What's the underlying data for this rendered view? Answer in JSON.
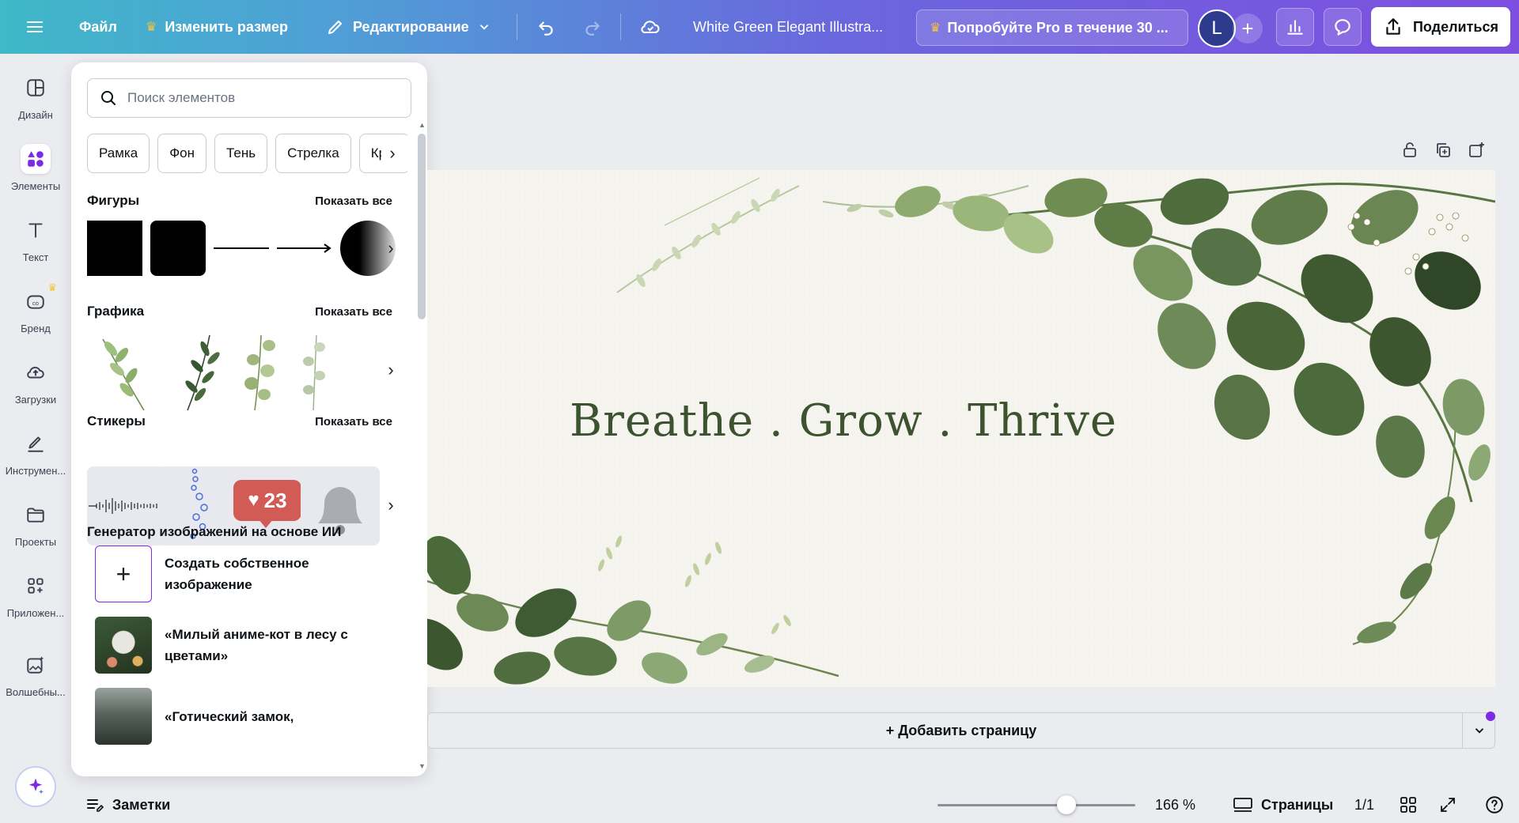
{
  "topbar": {
    "file_label": "Файл",
    "resize_label": "Изменить размер",
    "edit_label": "Редактирование",
    "doc_title": "White Green Elegant Illustra...",
    "pro_label": "Попробуйте Pro в течение 30 ...",
    "avatar_letter": "L",
    "share_label": "Поделиться"
  },
  "rail": {
    "items": [
      {
        "label": "Дизайн",
        "icon": "layout-icon"
      },
      {
        "label": "Элементы",
        "icon": "shapes-icon"
      },
      {
        "label": "Текст",
        "icon": "text-icon"
      },
      {
        "label": "Бренд",
        "icon": "brand-icon"
      },
      {
        "label": "Загрузки",
        "icon": "upload-cloud-icon"
      },
      {
        "label": "Инструмен...",
        "icon": "pen-tool-icon"
      },
      {
        "label": "Проекты",
        "icon": "folder-icon"
      },
      {
        "label": "Приложен...",
        "icon": "apps-icon"
      },
      {
        "label": "Волшебны...",
        "icon": "magic-media-icon"
      }
    ]
  },
  "panel": {
    "search_placeholder": "Поиск элементов",
    "chips": [
      "Рамка",
      "Фон",
      "Тень",
      "Стрелка",
      "Круг"
    ],
    "shapes_title": "Фигуры",
    "graphics_title": "Графика",
    "stickers_title": "Стикеры",
    "show_all": "Показать все",
    "sticker_like_count": "23",
    "ai_title": "Генератор изображений на основе ИИ",
    "ai_items": [
      "Создать собственное изображение",
      "«Милый аниме-кот в лесу с цветами»",
      "«Готический замок,"
    ]
  },
  "canvas": {
    "headline": "Breathe .  Grow . Thrive",
    "add_page": "+ Добавить страницу"
  },
  "bottombar": {
    "notes_label": "Заметки",
    "zoom": "166 %",
    "zoom_fraction": 0.65,
    "pages_label": "Страницы",
    "page_count": "1/1"
  },
  "colors": {
    "accent": "#7d2ae8",
    "headline": "#3d5330",
    "leaf_dark": "#4a6b3a",
    "leaf_light": "#8fae76"
  }
}
